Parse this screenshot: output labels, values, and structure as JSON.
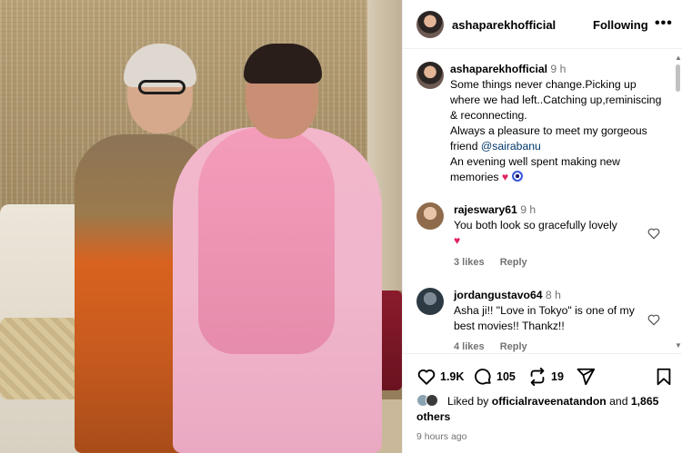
{
  "post": {
    "username": "asharekhofficial",
    "follow_label": "Following"
  },
  "caption": {
    "username": "ashaparekhofficial",
    "time": "9 h",
    "text_1": "Some things never change.Picking up where we had left..Catching up,reminiscing & reconnecting.",
    "text_2": "Always a pleasure to meet my gorgeous friend ",
    "mention": "@sairabanu",
    "text_3": "An evening well spent making new memories "
  },
  "comments": [
    {
      "username": "rajeswary61",
      "time": "9 h",
      "text": "You both look so gracefully lovely",
      "likes": "3 likes",
      "reply_label": "Reply"
    },
    {
      "username": "jordangustavo64",
      "time": "8 h",
      "text": "Asha ji!! \"Love in Tokyo\" is one of my best movies!! Thankz!!",
      "likes": "4 likes",
      "reply_label": "Reply"
    }
  ],
  "actions": {
    "like_count": "1.9K",
    "comment_count": "105",
    "share_count": "19"
  },
  "liked_by": {
    "prefix": "Liked by ",
    "user": "officialraveenatandon",
    "middle": " and ",
    "count": "1,865",
    "suffix": " others"
  },
  "timestamp": "9 hours ago",
  "colors": {
    "accent_link": "#00376b",
    "secondary_text": "#737373",
    "heart": "#e0245e"
  },
  "icons": [
    "more-icon",
    "heart-icon",
    "comment-icon",
    "share-icon",
    "send-icon",
    "save-icon"
  ]
}
